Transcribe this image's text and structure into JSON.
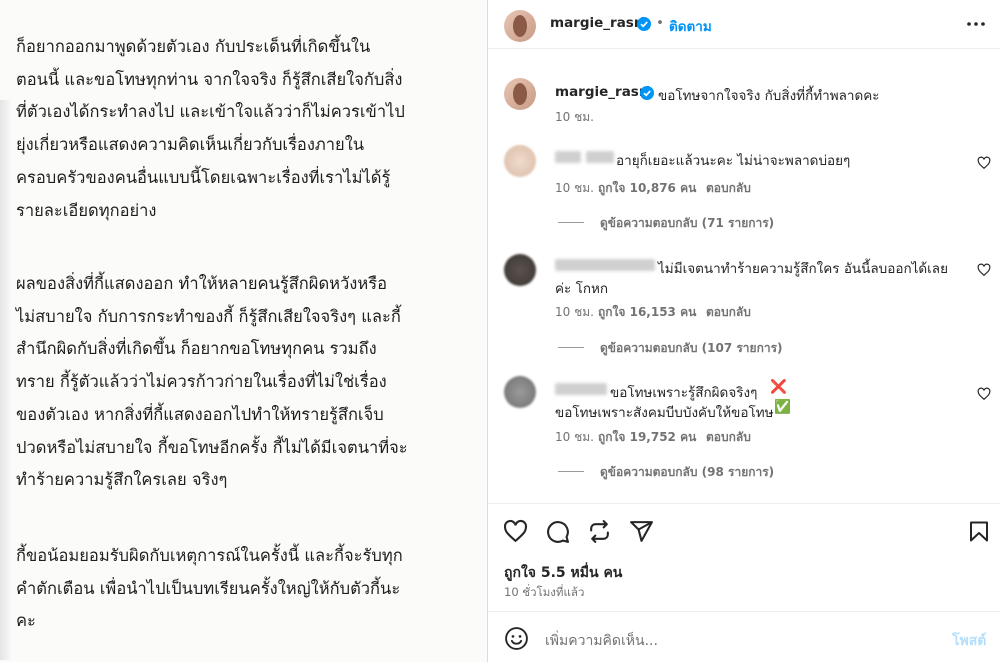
{
  "caption": {
    "paragraph1": [
      "ก็อยากออกมาพูดด้วยตัวเอง  กับประเด็นที่เกิดขึ้นใน",
      "ตอนนี้ และขอโทษทุกท่าน จากใจจริง ก็รู้สึกเสียใจกับสิ่ง",
      "ที่ตัวเองได้กระทำลงไป และเข้าใจแล้วว่าก็ไม่ควรเข้าไป",
      "ยุ่งเกี่ยวหรือแสดงความคิดเห็นเกี่ยวกับเรื่องภายใน",
      "ครอบครัวของคนอื่นแบบนี้โดยเฉพาะเรื่องที่เราไม่ได้รู้",
      "รายละเอียดทุกอย่าง"
    ],
    "paragraph2": [
      "ผลของสิ่งที่กี้แสดงออก ทำให้หลายคนรู้สึกผิดหวังหรือ",
      "ไม่สบายใจ กับการกระทำของกี้  ก็รู้สึกเสียใจจริงๆ และกี้",
      "สำนึกผิดกับสิ่งที่เกิดขึ้น ก็อยากขอโทษทุกคน รวมถึง",
      "ทราย กี้รู้ตัวแล้วว่าไม่ควรก้าวก่ายในเรื่องที่ไม่ใช่เรื่อง",
      "ของตัวเอง หากสิ่งที่กี้แสดงออกไปทำให้ทรายรู้สึกเจ็บ",
      "ปวดหรือไม่สบายใจ กี้ขอโทษอีกครั้ง กี้ไม่ได้มีเจตนาที่จะ",
      "ทำร้ายความรู้สึกใครเลย จริงๆ"
    ],
    "paragraph3": [
      "กี้ขอน้อมยอมรับผิดกับเหตุการณ์ในครั้งนี้ และกี้จะรับทุก",
      "คำตักเตือน เพื่อนำไปเป็นบทเรียนครั้งใหญ่ให้กับตัวกี้นะ",
      "คะ"
    ]
  },
  "header": {
    "username": "margie_rasri",
    "separator": "•",
    "follow_label": "ติดตาม",
    "more_icon": "more-horizontal-icon"
  },
  "post_caption": {
    "username": "margie_rasri",
    "text": "ขอโทษจากใจจริง กับสิ่งที่กี้ทำพลาดคะ",
    "time": "10 ชม."
  },
  "comments": [
    {
      "text": "อายุก็เยอะแล้วนะคะ ไม่น่าจะพลาดบ่อยๆ",
      "text2": "",
      "time": "10 ชม.",
      "likes": "ถูกใจ 10,876 คน",
      "reply_label": "ตอบกลับ",
      "view_replies": "ดูข้อความตอบกลับ (71 รายการ)"
    },
    {
      "text": "ไม่มีเจตนาทำร้ายความรู้สึกใคร อันนี้ลบออกได้เลย",
      "text2": "ค่ะ โกหก",
      "time": "10 ชม.",
      "likes": "ถูกใจ 16,153 คน",
      "reply_label": "ตอบกลับ",
      "view_replies": "ดูข้อความตอบกลับ (107 รายการ)"
    },
    {
      "text": "ขอโทษเพราะรู้สึกผิดจริงๆ",
      "emoji1": "❌",
      "text2": "ขอโทษเพราะสังคมบีบบังคับให้ขอโทษ",
      "emoji2": "✅",
      "time": "10 ชม.",
      "likes": "ถูกใจ 19,752 คน",
      "reply_label": "ตอบกลับ",
      "view_replies": "ดูข้อความตอบกลับ (98 รายการ)"
    }
  ],
  "actions": {
    "icons": [
      "heart-icon",
      "comment-icon",
      "share-icon",
      "send-icon",
      "bookmark-icon"
    ],
    "likes": "ถูกใจ 5.5 หมื่น คน",
    "time": "10 ชั่วโมงที่แล้ว"
  },
  "composer": {
    "placeholder": "เพิ่มความคิดเห็น...",
    "post_label": "โพสต์"
  },
  "colors": {
    "accent": "#0095f6",
    "verified": "#0095f6",
    "post_disabled": "#b2dffc"
  }
}
